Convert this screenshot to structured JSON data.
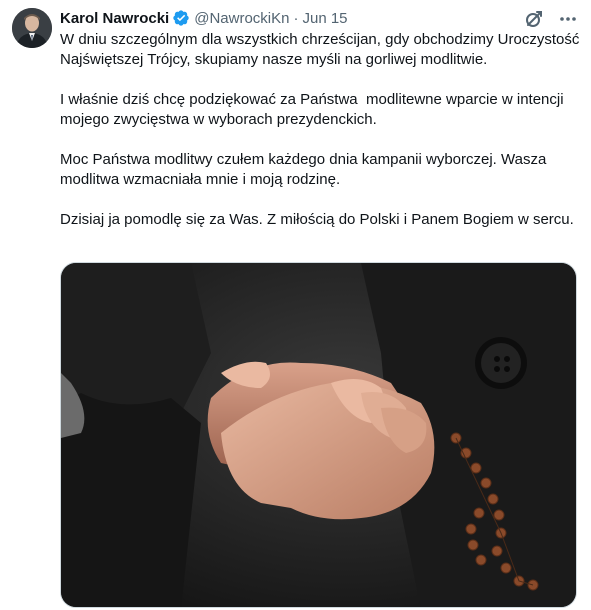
{
  "author": {
    "name": "Karol Nawrocki",
    "handle": "@NawrockiKn",
    "separator": "·",
    "date": "Jun 15",
    "verified": true
  },
  "icons": {
    "verified": "verified-badge-icon",
    "grok": "grok-icon",
    "more": "more-icon"
  },
  "colors": {
    "verified": "#1d9bf0",
    "secondary_text": "#536471"
  },
  "tweet": {
    "paragraphs": [
      "W dniu szczególnym dla wszystkich chrześcijan, gdy obchodzimy Uroczystość Najświętszej Trójcy, skupiamy nasze myśli na gorliwej modlitwie.",
      "I właśnie dziś chcę podziękować za Państwa  modlitewne wparcie w intencji mojego zwycięstwa w wyborach prezydenckich.",
      "Moc Państwa modlitwy czułem każdego dnia kampanii wyborczej. Wasza modlitwa wzmacniała mnie i moją rodzinę.",
      "Dzisiaj ja pomodlę się za Was. Z miłością do Polski i Panem Bogiem w sercu."
    ]
  }
}
